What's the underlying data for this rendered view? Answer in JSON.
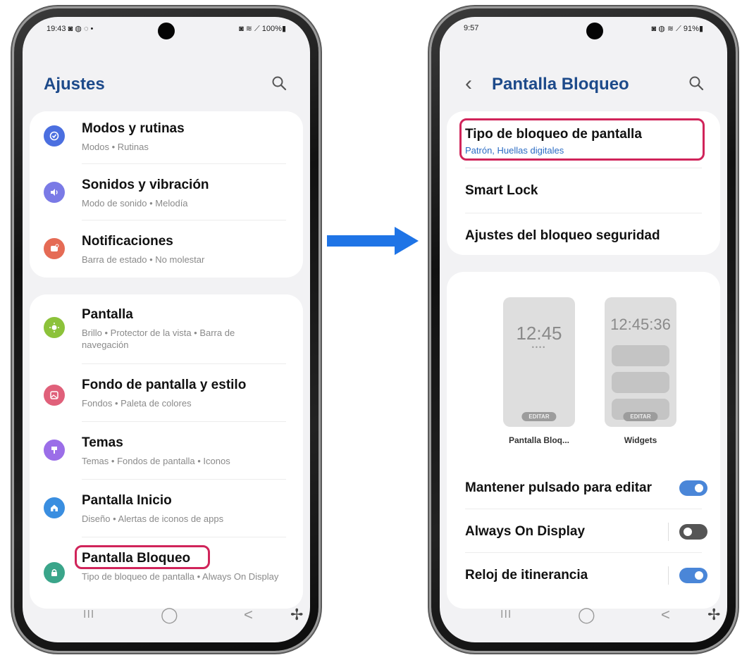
{
  "left_phone": {
    "status": {
      "time": "19:43 ◙ ◍ ◌ •",
      "right": "◙ ≋ ⟋ 100%▮"
    },
    "title": "Ajustes",
    "items": [
      {
        "title": "Modos y rutinas",
        "subtitle": "Modos  •  Rutinas",
        "icon": "modes-icon",
        "color": "#4b6fe0"
      },
      {
        "title": "Sonidos y vibración",
        "subtitle": "Modo de sonido  •  Melodía",
        "icon": "sound-icon",
        "color": "#7a7ae6"
      },
      {
        "title": "Notificaciones",
        "subtitle": "Barra de estado  •  No molestar",
        "icon": "notifications-icon",
        "color": "#e56b55"
      },
      {
        "title": "Pantalla",
        "subtitle": "Brillo  •  Protector de la vista  •  Barra de navegación",
        "icon": "display-icon",
        "color": "#8cc23a"
      },
      {
        "title": "Fondo de pantalla y estilo",
        "subtitle": "Fondos  •  Paleta de colores",
        "icon": "wallpaper-icon",
        "color": "#e0607a"
      },
      {
        "title": "Temas",
        "subtitle": "Temas  •  Fondos de pantalla  •  Iconos",
        "icon": "themes-icon",
        "color": "#9b6ee8"
      },
      {
        "title": "Pantalla Inicio",
        "subtitle": "Diseño  •  Alertas de iconos de apps",
        "icon": "home-icon",
        "color": "#3a8ee0"
      },
      {
        "title": "Pantalla Bloqueo",
        "subtitle": "Tipo de bloqueo de pantalla  •  Always On Display",
        "icon": "lock-icon",
        "color": "#3aa58a"
      }
    ]
  },
  "right_phone": {
    "status": {
      "time": "9:57",
      "right": "◙ ◍ ≋ ⟋ 91%▮"
    },
    "title": "Pantalla Bloqueo",
    "lock_type": {
      "title": "Tipo de bloqueo de pantalla",
      "subtitle": "Patrón, Huellas digitales"
    },
    "smart_lock": "Smart Lock",
    "security_settings": "Ajustes del bloqueo seguridad",
    "previews": {
      "lock": {
        "clock": "12:45",
        "dots": "••••",
        "edit": "EDITAR",
        "label": "Pantalla Bloq..."
      },
      "widgets": {
        "clock": "12:45:36",
        "edit": "EDITAR",
        "label": "Widgets"
      }
    },
    "toggles": [
      {
        "label": "Mantener pulsado para editar",
        "on": true
      },
      {
        "label": "Always On Display",
        "on": false
      },
      {
        "label": "Reloj de itinerancia",
        "on": true
      }
    ]
  },
  "navbar": {
    "recents": "III",
    "home": "◯",
    "back": "<",
    "accessibility": "✢"
  },
  "colors": {
    "accent": "#2b6cc4",
    "highlight": "#d0245a",
    "toggle_on": "#4a86d8",
    "arrow": "#1f74e6"
  }
}
